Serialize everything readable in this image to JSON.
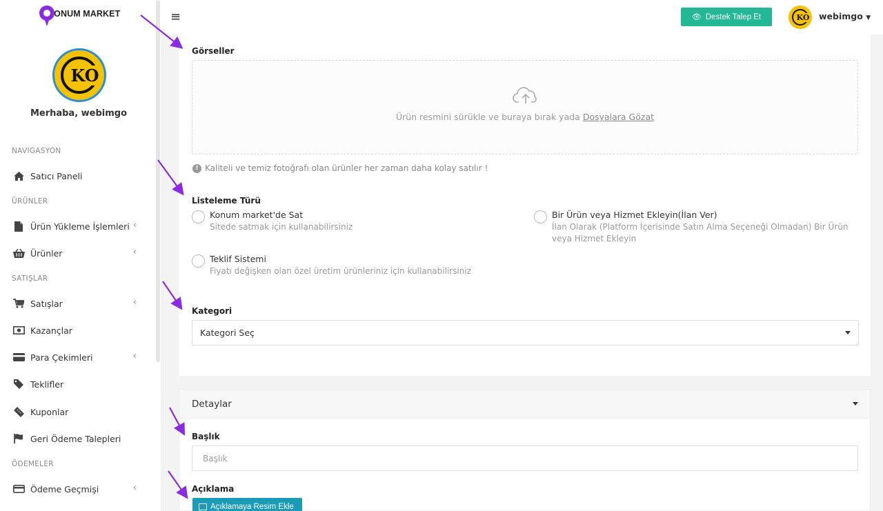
{
  "brand": {
    "name": "KONUM MARKET"
  },
  "sidebar": {
    "greeting": "Merhaba, webimgo",
    "sections": [
      {
        "heading": "NAVIGASYON"
      },
      {
        "heading": "ÜRÜNLER"
      },
      {
        "heading": "SATIŞLAR"
      },
      {
        "heading": "ÖDEMELER"
      }
    ],
    "items": [
      {
        "label": "Satıcı Paneli",
        "icon": "home-icon"
      },
      {
        "label": "Ürün Yükleme İşlemleri",
        "icon": "file-icon",
        "has_chevron": true
      },
      {
        "label": "Ürünler",
        "icon": "basket-icon",
        "has_chevron": true
      },
      {
        "label": "Satışlar",
        "icon": "cart-icon",
        "has_chevron": true
      },
      {
        "label": "Kazançlar",
        "icon": "money-icon"
      },
      {
        "label": "Para Çekimleri",
        "icon": "credit-card-icon",
        "has_chevron": true
      },
      {
        "label": "Teklifler",
        "icon": "tag-icon"
      },
      {
        "label": "Kuponlar",
        "icon": "ticket-icon"
      },
      {
        "label": "Geri Ödeme Talepleri",
        "icon": "flag-icon"
      },
      {
        "label": "Ödeme Geçmişi",
        "icon": "credit-card-icon",
        "has_chevron": true
      }
    ]
  },
  "topbar": {
    "support_label": "Destek Talep Et",
    "user_name": "webimgo",
    "avatar_text": "KO"
  },
  "images_section": {
    "label": "Görseller",
    "drop_text": "Ürün resmini sürükle ve buraya bırak yada ",
    "browse_link": "Dosyalara Gözat",
    "hint": "Kaliteli ve temiz fotoğrafı olan ürünler her zaman daha kolay satılır !"
  },
  "listing_type": {
    "label": "Listeleme Türü",
    "options": [
      {
        "title": "Konum market'de Sat",
        "desc": "Sitede satmak için kullanabilirsiniz"
      },
      {
        "title": "Bir Ürün veya Hizmet Ekleyin(İlan Ver)",
        "desc": "İlan Olarak (Platform İçerisinde Satın Alma Seçeneği Olmadan) Bir Ürün veya Hizmet Ekleyin"
      },
      {
        "title": "Teklif Sistemi",
        "desc": "Fiyatı değişken olan özel üretim ürünleriniz için kullanabilirsiniz"
      }
    ]
  },
  "category": {
    "label": "Kategori",
    "selected": "Kategori Seç"
  },
  "details": {
    "header": "Detaylar",
    "title_label": "Başlık",
    "title_placeholder": "Başlık",
    "description_label": "Açıklama",
    "add_image_button": "Açıklamaya Resim Ekle"
  },
  "colors": {
    "accent_green": "#22b896",
    "accent_teal": "#1a9bb8",
    "brand_purple": "#8b2be2",
    "arrow_purple": "#8a2be2"
  }
}
